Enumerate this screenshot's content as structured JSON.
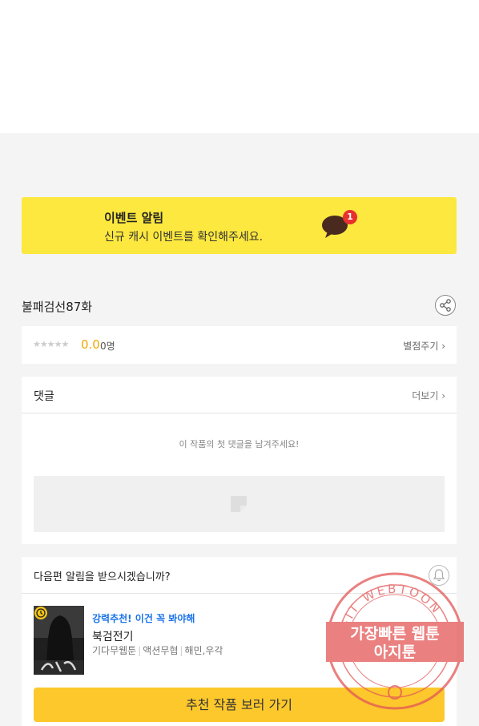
{
  "event_banner": {
    "title": "이벤트 알림",
    "subtitle": "신규 캐시 이벤트를 확인해주세요.",
    "badge_count": "1"
  },
  "episode": {
    "title": "불패검선87화"
  },
  "rating": {
    "stars": "★★★★★",
    "score": "0.0",
    "count": "0명",
    "rate_link": "별점주기 ›"
  },
  "comments": {
    "title": "댓글",
    "more_link": "더보기 ›",
    "empty_message": "이 작품의 첫 댓글을 남겨주세요!"
  },
  "notify": {
    "question": "다음편 알림을 받으시겠습니까?",
    "recommend": {
      "tag": "강력추천! 이건 꼭 봐야해",
      "name": "북검전기",
      "meta": [
        "기다무웹툰",
        "액션무협",
        "해민,우각"
      ]
    },
    "go_button": "추천 작품 보러 가기"
  },
  "watermark": {
    "ring_text": "AGIT WEBTOON",
    "line1": "가장빠른 웹툰",
    "line2": "아지툰"
  },
  "colors": {
    "event_bg": "#fce83f",
    "score": "#f0a800",
    "rec_tag": "#1a73e8",
    "go_button": "#fcc82c",
    "badge": "#e8302f",
    "stamp": "#e35656"
  }
}
